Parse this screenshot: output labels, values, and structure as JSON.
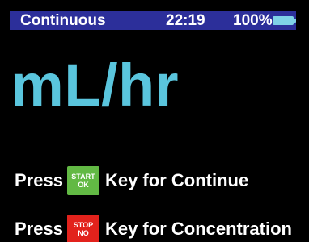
{
  "status_bar": {
    "mode": "Continuous",
    "time": "22:19",
    "battery_percent": "100%",
    "battery_icon": "battery-full-icon"
  },
  "main": {
    "unit": "mL/hr"
  },
  "instructions": [
    {
      "press_text": "Press",
      "key_top": "START",
      "key_bottom": "OK",
      "key_color": "#62b944",
      "action_text": "Key for Continue"
    },
    {
      "press_text": "Press",
      "key_top": "STOP",
      "key_bottom": "NO",
      "key_color": "#e2221c",
      "action_text": "Key for Concentration"
    }
  ],
  "colors": {
    "background": "#000000",
    "status_bar_background": "#2c2f9a",
    "unit_text": "#5ac5dd",
    "battery": "#7fd2e7"
  }
}
